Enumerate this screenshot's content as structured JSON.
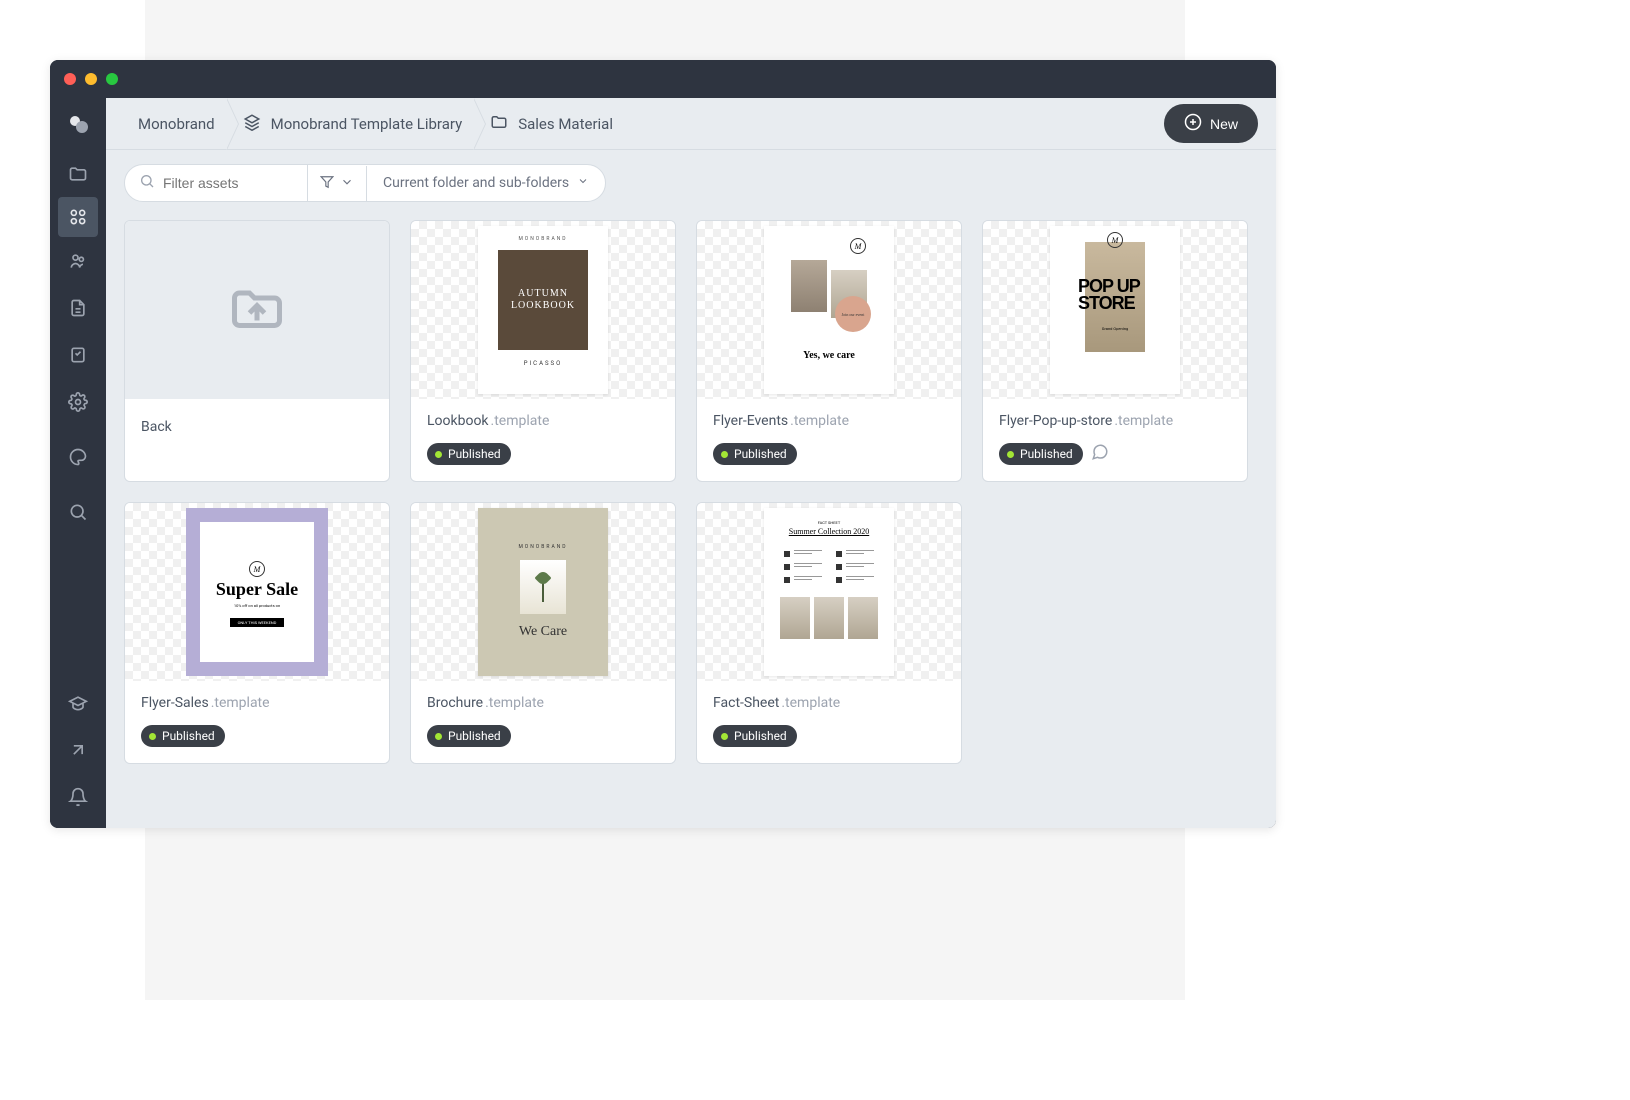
{
  "breadcrumbs": [
    {
      "label": "Monobrand",
      "icon": null
    },
    {
      "label": "Monobrand Template Library",
      "icon": "stack"
    },
    {
      "label": "Sales Material",
      "icon": "folder"
    }
  ],
  "new_button": {
    "label": "New"
  },
  "filter": {
    "placeholder": "Filter assets",
    "scope": "Current folder and sub-folders"
  },
  "back_card": {
    "label": "Back"
  },
  "cards": [
    {
      "name": "Lookbook",
      "ext": ".template",
      "status": "Published",
      "has_comments": false,
      "thumb": "lookbook"
    },
    {
      "name": "Flyer-Events",
      "ext": ".template",
      "status": "Published",
      "has_comments": false,
      "thumb": "events"
    },
    {
      "name": "Flyer-Pop-up-store",
      "ext": ".template",
      "status": "Published",
      "has_comments": true,
      "thumb": "popup"
    },
    {
      "name": "Flyer-Sales",
      "ext": ".template",
      "status": "Published",
      "has_comments": false,
      "thumb": "sales"
    },
    {
      "name": "Brochure",
      "ext": ".template",
      "status": "Published",
      "has_comments": false,
      "thumb": "brochure"
    },
    {
      "name": "Fact-Sheet",
      "ext": ".template",
      "status": "Published",
      "has_comments": false,
      "thumb": "factsheet"
    }
  ],
  "thumbs": {
    "lookbook": {
      "header": "MONOBRAND",
      "main": "AUTUMN\nLOOKBOOK",
      "footer": "PICASSO"
    },
    "events": {
      "circle_text": "Join our event",
      "title": "Yes, we care"
    },
    "popup": {
      "main": "POP\nUP\nSTORE",
      "sub": "Grand Opening"
    },
    "sales": {
      "main": "Super\nSale",
      "sub": "10% off on all products on",
      "bar": "ONLY THIS WEEKEND"
    },
    "brochure": {
      "header": "MONOBRAND",
      "title": "We Care"
    },
    "factsheet": {
      "eyebrow": "FACT SHEET",
      "title": "Summer Collection 2020"
    }
  }
}
